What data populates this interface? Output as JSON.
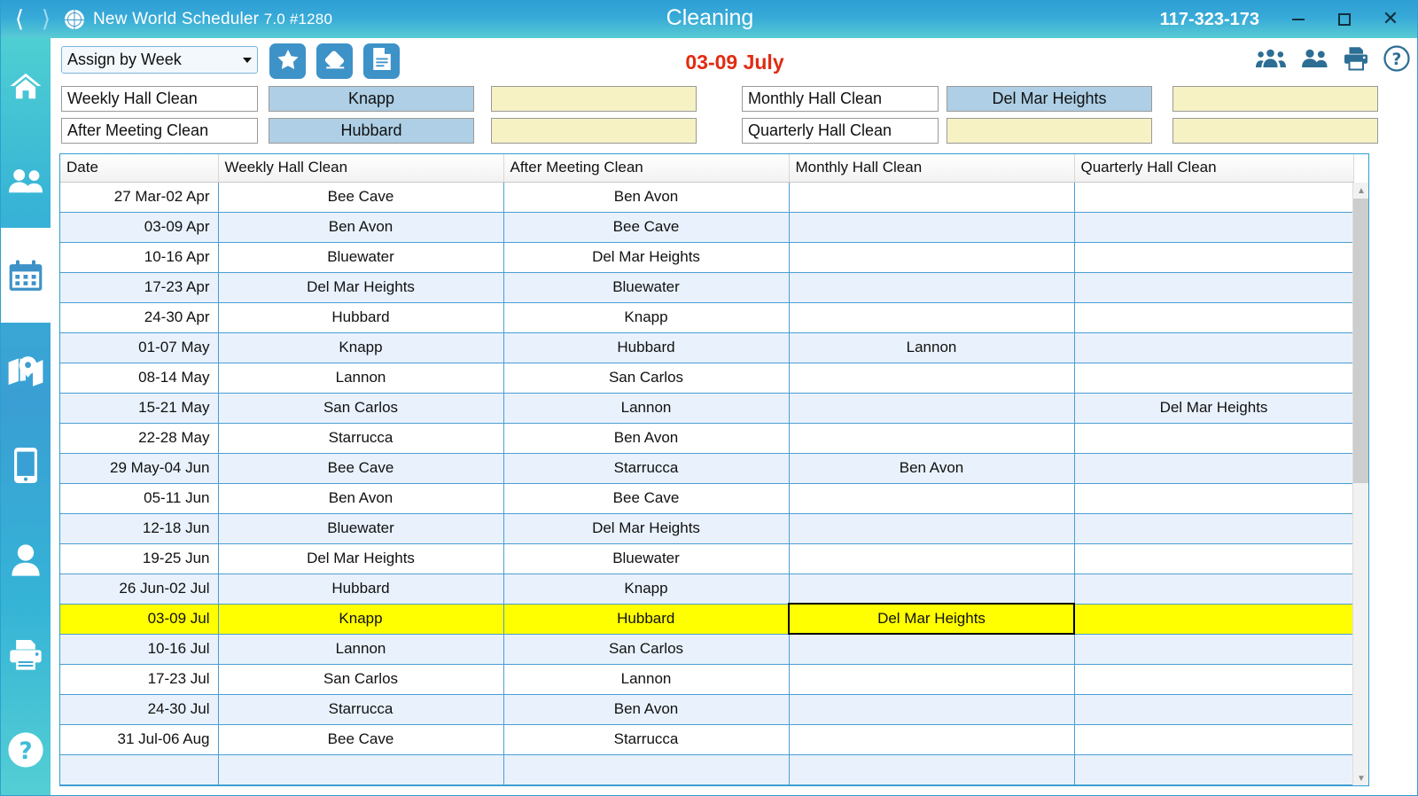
{
  "titlebar": {
    "back_icon": "chevron-left-icon",
    "forward_icon": "chevron-right-icon",
    "app_name": "New World Scheduler",
    "app_version": "7.0 #1280",
    "window_title": "Cleaning",
    "doc_id": "117-323-173",
    "minimize_label": "Minimize",
    "maximize_label": "Maximize",
    "close_label": "Close"
  },
  "sidebar": {
    "items": [
      {
        "name": "home",
        "icon": "home-icon",
        "active": false
      },
      {
        "name": "congregation",
        "icon": "people-group-icon",
        "active": false
      },
      {
        "name": "schedules",
        "icon": "calendar-icon",
        "active": true
      },
      {
        "name": "territories",
        "icon": "map-icon",
        "active": false
      },
      {
        "name": "mobile",
        "icon": "phone-icon",
        "active": false
      },
      {
        "name": "publisher",
        "icon": "person-icon",
        "active": false
      },
      {
        "name": "print",
        "icon": "printer-icon",
        "active": false
      },
      {
        "name": "help",
        "icon": "help-circle-icon",
        "active": false
      }
    ]
  },
  "toolbar": {
    "assign_mode": "Assign by Week",
    "assign_mode_options": [
      "Assign by Week"
    ],
    "buttons": [
      {
        "name": "favorite",
        "icon": "star-icon"
      },
      {
        "name": "erase",
        "icon": "eraser-icon"
      },
      {
        "name": "report",
        "icon": "document-icon"
      }
    ],
    "week_label": "03-09 July",
    "right_icons": [
      {
        "name": "groups",
        "icon": "people-group-icon"
      },
      {
        "name": "pair",
        "icon": "people-pair-icon"
      },
      {
        "name": "print",
        "icon": "printer-icon"
      },
      {
        "name": "help",
        "icon": "help-circle-icon"
      }
    ]
  },
  "assign_fields": {
    "rows": [
      {
        "label": "Weekly Hall Clean",
        "value": "Knapp",
        "value_style": "blue",
        "extra": "",
        "extra_style": "yellow"
      },
      {
        "label": "After Meeting Clean",
        "value": "Hubbard",
        "value_style": "blue",
        "extra": "",
        "extra_style": "yellow"
      },
      {
        "label": "Monthly Hall Clean",
        "value": "Del Mar Heights",
        "value_style": "blue",
        "extra": "",
        "extra_style": "yellow"
      },
      {
        "label": "Quarterly Hall Clean",
        "value": "",
        "value_style": "yellow",
        "extra": "",
        "extra_style": "yellow"
      }
    ]
  },
  "table": {
    "columns": [
      "Date",
      "Weekly Hall Clean",
      "After Meeting Clean",
      "Monthly Hall Clean",
      "Quarterly Hall Clean"
    ],
    "highlighted_row": "03-09 Jul",
    "selected_cell": {
      "row": "03-09 Jul",
      "column": "Monthly Hall Clean"
    },
    "rows": [
      {
        "date": "27 Mar-02 Apr",
        "weekly": "Bee Cave",
        "after": "Ben Avon",
        "monthly": "",
        "quarterly": ""
      },
      {
        "date": "03-09 Apr",
        "weekly": "Ben Avon",
        "after": "Bee Cave",
        "monthly": "",
        "quarterly": ""
      },
      {
        "date": "10-16 Apr",
        "weekly": "Bluewater",
        "after": "Del Mar Heights",
        "monthly": "",
        "quarterly": ""
      },
      {
        "date": "17-23 Apr",
        "weekly": "Del Mar Heights",
        "after": "Bluewater",
        "monthly": "",
        "quarterly": ""
      },
      {
        "date": "24-30 Apr",
        "weekly": "Hubbard",
        "after": "Knapp",
        "monthly": "",
        "quarterly": ""
      },
      {
        "date": "01-07 May",
        "weekly": "Knapp",
        "after": "Hubbard",
        "monthly": "Lannon",
        "quarterly": ""
      },
      {
        "date": "08-14 May",
        "weekly": "Lannon",
        "after": "San Carlos",
        "monthly": "",
        "quarterly": ""
      },
      {
        "date": "15-21 May",
        "weekly": "San Carlos",
        "after": "Lannon",
        "monthly": "",
        "quarterly": "Del Mar Heights"
      },
      {
        "date": "22-28 May",
        "weekly": "Starrucca",
        "after": "Ben Avon",
        "monthly": "",
        "quarterly": ""
      },
      {
        "date": "29 May-04 Jun",
        "weekly": "Bee Cave",
        "after": "Starrucca",
        "monthly": "Ben Avon",
        "quarterly": ""
      },
      {
        "date": "05-11 Jun",
        "weekly": "Ben Avon",
        "after": "Bee Cave",
        "monthly": "",
        "quarterly": ""
      },
      {
        "date": "12-18 Jun",
        "weekly": "Bluewater",
        "after": "Del Mar Heights",
        "monthly": "",
        "quarterly": ""
      },
      {
        "date": "19-25 Jun",
        "weekly": "Del Mar Heights",
        "after": "Bluewater",
        "monthly": "",
        "quarterly": ""
      },
      {
        "date": "26 Jun-02 Jul",
        "weekly": "Hubbard",
        "after": "Knapp",
        "monthly": "",
        "quarterly": ""
      },
      {
        "date": "03-09 Jul",
        "weekly": "Knapp",
        "after": "Hubbard",
        "monthly": "Del Mar Heights",
        "quarterly": ""
      },
      {
        "date": "10-16 Jul",
        "weekly": "Lannon",
        "after": "San Carlos",
        "monthly": "",
        "quarterly": ""
      },
      {
        "date": "17-23 Jul",
        "weekly": "San Carlos",
        "after": "Lannon",
        "monthly": "",
        "quarterly": ""
      },
      {
        "date": "24-30 Jul",
        "weekly": "Starrucca",
        "after": "Ben Avon",
        "monthly": "",
        "quarterly": ""
      },
      {
        "date": "31 Jul-06 Aug",
        "weekly": "Bee Cave",
        "after": "Starrucca",
        "monthly": "",
        "quarterly": ""
      },
      {
        "date": "",
        "weekly": "",
        "after": "",
        "monthly": "",
        "quarterly": ""
      }
    ]
  },
  "scrollbar": {
    "up_arrow": "chevron-up-icon",
    "down_arrow": "chevron-down-icon"
  },
  "colors": {
    "accent_blue": "#3d92c8",
    "titlebar_gradient_start": "#2f9fd4",
    "titlebar_gradient_end": "#58cbd4",
    "highlight_yellow": "#ffff00",
    "field_blue": "#aecfe5",
    "field_yellow": "#f7f2c4",
    "week_label_red": "#e22b12",
    "row_stripe": "#e9f2fc",
    "grid_line": "#4b9ed4"
  }
}
